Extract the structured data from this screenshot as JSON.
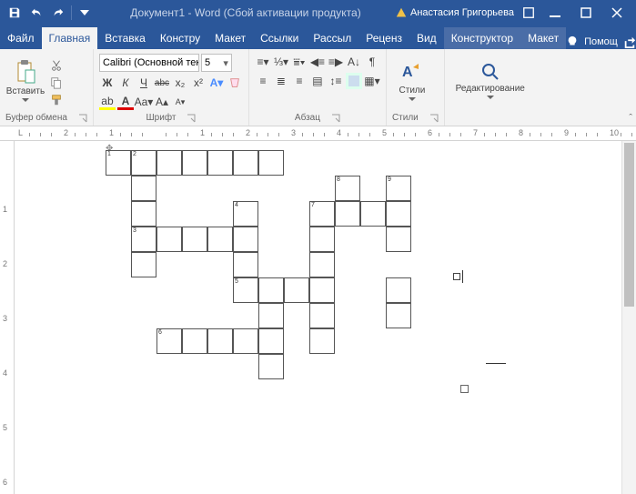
{
  "titlebar": {
    "doc_name": "Документ1",
    "app_suffix": " - Word ",
    "activation_warn": "(Сбой активации продукта)",
    "user_warn_icon": "warning-icon",
    "user_name": "Анастасия Григорьева"
  },
  "tabs": {
    "file": "Файл",
    "items": [
      "Главная",
      "Вставка",
      "Констру",
      "Макет",
      "Ссылки",
      "Рассыл",
      "Реценз",
      "Вид",
      "Конструктор",
      "Макет"
    ],
    "active_index": 0,
    "context_indices": [
      8,
      9
    ],
    "help": "Помощ"
  },
  "ribbon": {
    "clipboard": {
      "label": "Буфер обмена",
      "paste": "Вставить"
    },
    "font": {
      "label": "Шрифт",
      "name": "Calibri (Основной тек",
      "size": "5",
      "bold": "Ж",
      "italic": "К",
      "underline": "Ч",
      "strike": "abc",
      "sub": "x₂",
      "sup": "x²"
    },
    "paragraph": {
      "label": "Абзац"
    },
    "styles": {
      "label": "Стили",
      "btn": "Стили"
    },
    "editing": {
      "label": "",
      "btn": "Редактирование"
    }
  },
  "ruler": {
    "h_marks": [
      "L",
      "2",
      "1",
      "",
      "1",
      "2",
      "3",
      "4",
      "5",
      "6",
      "7",
      "8",
      "9",
      "10"
    ],
    "v_marks": [
      "",
      "1",
      "2",
      "3",
      "4",
      "5",
      "6"
    ]
  },
  "crossword": {
    "cell": 28,
    "cells": [
      [
        0,
        1
      ],
      [
        1,
        1
      ],
      [
        2,
        1
      ],
      [
        3,
        1
      ],
      [
        4,
        1
      ],
      [
        5,
        1
      ],
      [
        6,
        1
      ],
      [
        1,
        2
      ],
      [
        9,
        2
      ],
      [
        11,
        2
      ],
      [
        1,
        3
      ],
      [
        5,
        3
      ],
      [
        8,
        3
      ],
      [
        9,
        3
      ],
      [
        10,
        3
      ],
      [
        11,
        3
      ],
      [
        1,
        4
      ],
      [
        2,
        4
      ],
      [
        3,
        4
      ],
      [
        4,
        4
      ],
      [
        5,
        4
      ],
      [
        8,
        4
      ],
      [
        11,
        4
      ],
      [
        1,
        5
      ],
      [
        5,
        5
      ],
      [
        8,
        5
      ],
      [
        11,
        4
      ],
      [
        5,
        6
      ],
      [
        6,
        6
      ],
      [
        7,
        6
      ],
      [
        8,
        6
      ],
      [
        11,
        6
      ],
      [
        6,
        7
      ],
      [
        8,
        7
      ],
      [
        11,
        7
      ],
      [
        2,
        8
      ],
      [
        3,
        8
      ],
      [
        4,
        8
      ],
      [
        5,
        8
      ],
      [
        6,
        8
      ],
      [
        8,
        8
      ],
      [
        6,
        9
      ]
    ],
    "numbers": [
      {
        "n": "1",
        "c": 0,
        "r": 1
      },
      {
        "n": "2",
        "c": 1,
        "r": 1
      },
      {
        "n": "8",
        "c": 9,
        "r": 2
      },
      {
        "n": "9",
        "c": 11,
        "r": 2
      },
      {
        "n": "4",
        "c": 5,
        "r": 3
      },
      {
        "n": "7",
        "c": 8,
        "r": 3
      },
      {
        "n": "3",
        "c": 1,
        "r": 4
      },
      {
        "n": "5",
        "c": 5,
        "r": 6
      },
      {
        "n": "6",
        "c": 2,
        "r": 8
      }
    ]
  }
}
